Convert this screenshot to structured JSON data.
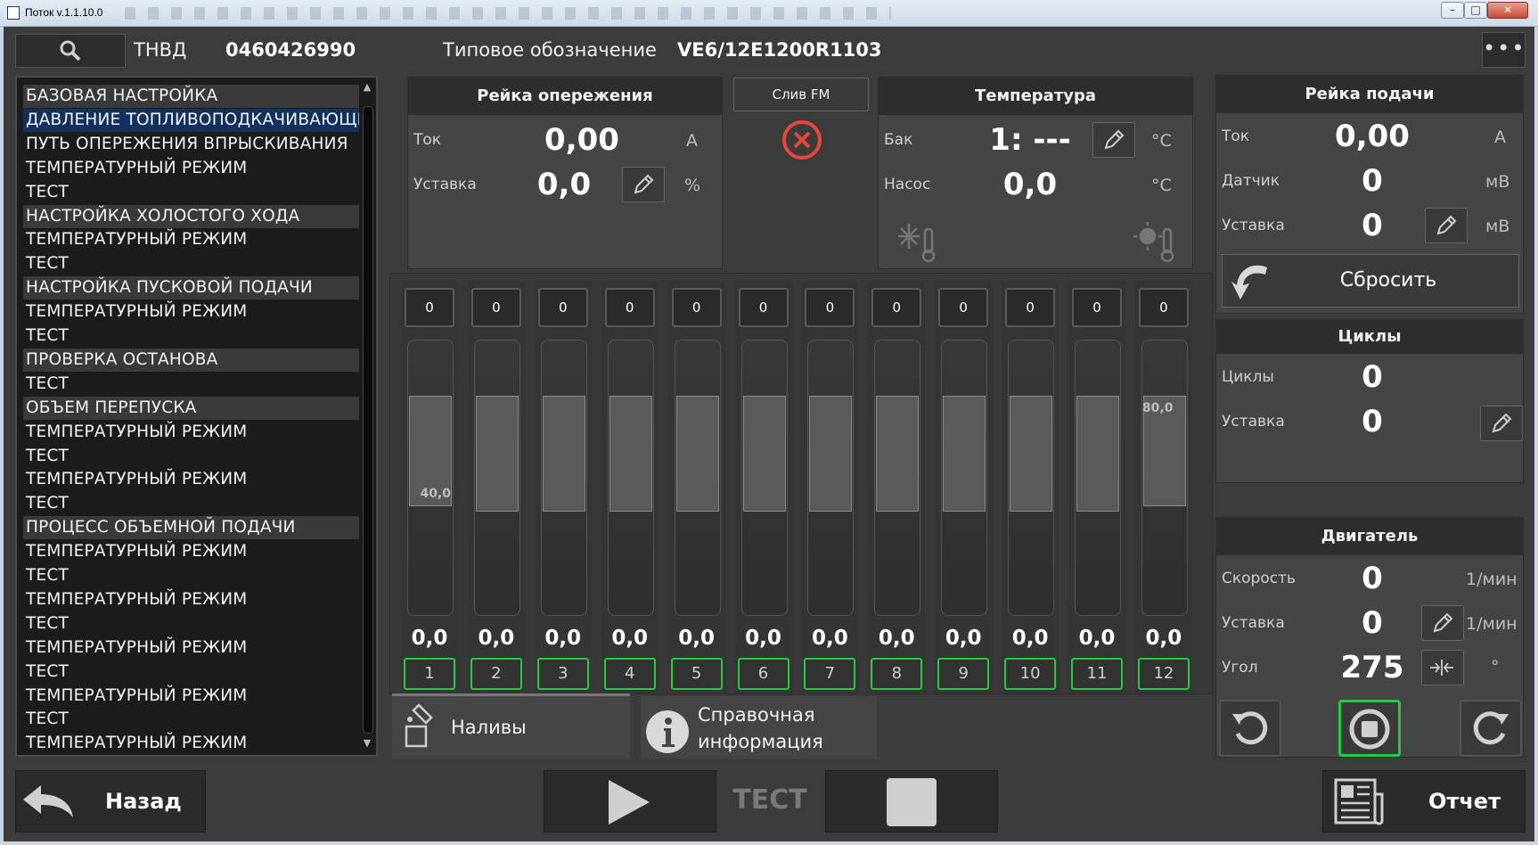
{
  "window": {
    "title": "Поток v.1.1.10.0"
  },
  "header": {
    "pump_label": "ТНВД",
    "pump_value": "0460426990",
    "type_label": "Типовое обозначение",
    "type_value": "VE6/12E1200R1103"
  },
  "test_list": {
    "items": [
      {
        "label": "БАЗОВАЯ НАСТРОЙКА",
        "kind": "section"
      },
      {
        "label": "ДАВЛЕНИЕ ТОПЛИВОПОДКАЧИВАЮЩЕГО НАСОСА",
        "kind": "selected"
      },
      {
        "label": "ПУТЬ ОПЕРЕЖЕНИЯ ВПРЫСКИВАНИЯ",
        "kind": "item"
      },
      {
        "label": "ТЕМПЕРАТУРНЫЙ РЕЖИМ",
        "kind": "item"
      },
      {
        "label": "ТЕСТ",
        "kind": "item"
      },
      {
        "label": "НАСТРОЙКА ХОЛОСТОГО ХОДА",
        "kind": "section"
      },
      {
        "label": "ТЕМПЕРАТУРНЫЙ РЕЖИМ",
        "kind": "item"
      },
      {
        "label": "ТЕСТ",
        "kind": "item"
      },
      {
        "label": "НАСТРОЙКА ПУСКОВОЙ ПОДАЧИ",
        "kind": "section"
      },
      {
        "label": "ТЕМПЕРАТУРНЫЙ РЕЖИМ",
        "kind": "item"
      },
      {
        "label": "ТЕСТ",
        "kind": "item"
      },
      {
        "label": "ПРОВЕРКА ОСТАНОВА",
        "kind": "section"
      },
      {
        "label": "ТЕСТ",
        "kind": "item"
      },
      {
        "label": "ОБЪЕМ ПЕРЕПУСКА",
        "kind": "section"
      },
      {
        "label": "ТЕМПЕРАТУРНЫЙ РЕЖИМ",
        "kind": "item"
      },
      {
        "label": "ТЕСТ",
        "kind": "item"
      },
      {
        "label": "ТЕМПЕРАТУРНЫЙ РЕЖИМ",
        "kind": "item"
      },
      {
        "label": "ТЕСТ",
        "kind": "item"
      },
      {
        "label": "ПРОЦЕСС ОБЪЕМНОЙ ПОДАЧИ",
        "kind": "section"
      },
      {
        "label": "ТЕМПЕРАТУРНЫЙ РЕЖИМ",
        "kind": "item"
      },
      {
        "label": "ТЕСТ",
        "kind": "item"
      },
      {
        "label": "ТЕМПЕРАТУРНЫЙ РЕЖИМ",
        "kind": "item"
      },
      {
        "label": "ТЕСТ",
        "kind": "item"
      },
      {
        "label": "ТЕМПЕРАТУРНЫЙ РЕЖИМ",
        "kind": "item"
      },
      {
        "label": "ТЕСТ",
        "kind": "item"
      },
      {
        "label": "ТЕМПЕРАТУРНЫЙ РЕЖИМ",
        "kind": "item"
      },
      {
        "label": "ТЕСТ",
        "kind": "item"
      },
      {
        "label": "ТЕМПЕРАТУРНЫЙ РЕЖИМ",
        "kind": "item"
      }
    ]
  },
  "advance_rack": {
    "title": "Рейка опережения",
    "current_label": "Ток",
    "current_value": "0,00",
    "current_unit": "A",
    "setpoint_label": "Уставка",
    "setpoint_value": "0,0",
    "setpoint_unit": "%"
  },
  "drain": {
    "label": "Слив FM",
    "status_icon": "error-circle-icon",
    "status_color": "#e8473a"
  },
  "temperature": {
    "title": "Температура",
    "tank_label": "Бак",
    "tank_value": "1: ---",
    "tank_unit": "°C",
    "pump_label": "Насос",
    "pump_value": "0,0",
    "pump_unit": "°C"
  },
  "feed_rack": {
    "title": "Рейка подачи",
    "current_label": "Ток",
    "current_value": "0,00",
    "current_unit": "A",
    "sensor_label": "Датчик",
    "sensor_value": "0",
    "sensor_unit": "мВ",
    "setpoint_label": "Уставка",
    "setpoint_value": "0",
    "setpoint_unit": "мВ",
    "reset_label": "Сбросить"
  },
  "cycles": {
    "title": "Циклы",
    "cycles_label": "Циклы",
    "cycles_value": "0",
    "setpoint_label": "Уставка",
    "setpoint_value": "0"
  },
  "engine": {
    "title": "Двигатель",
    "speed_label": "Скорость",
    "speed_value": "0",
    "speed_unit": "1/мин",
    "setpoint_label": "Уставка",
    "setpoint_value": "0",
    "setpoint_unit": "1/мин",
    "angle_label": "Угол",
    "angle_value": "275",
    "angle_unit": "°"
  },
  "channels": [
    {
      "index": "1",
      "top": "0",
      "value": "0,0",
      "band": [
        40,
        80
      ],
      "marker": "40,0",
      "marker_at": "low"
    },
    {
      "index": "2",
      "top": "0",
      "value": "0,0",
      "band": [
        38,
        80
      ]
    },
    {
      "index": "3",
      "top": "0",
      "value": "0,0",
      "band": [
        38,
        80
      ]
    },
    {
      "index": "4",
      "top": "0",
      "value": "0,0",
      "band": [
        38,
        80
      ]
    },
    {
      "index": "5",
      "top": "0",
      "value": "0,0",
      "band": [
        38,
        80
      ]
    },
    {
      "index": "6",
      "top": "0",
      "value": "0,0",
      "band": [
        38,
        80
      ]
    },
    {
      "index": "7",
      "top": "0",
      "value": "0,0",
      "band": [
        38,
        80
      ]
    },
    {
      "index": "8",
      "top": "0",
      "value": "0,0",
      "band": [
        38,
        80
      ]
    },
    {
      "index": "9",
      "top": "0",
      "value": "0,0",
      "band": [
        38,
        80
      ]
    },
    {
      "index": "10",
      "top": "0",
      "value": "0,0",
      "band": [
        38,
        80
      ]
    },
    {
      "index": "11",
      "top": "0",
      "value": "0,0",
      "band": [
        38,
        80
      ]
    },
    {
      "index": "12",
      "top": "0",
      "value": "0,0",
      "band": [
        40,
        80
      ],
      "marker": "80,0",
      "marker_at": "high"
    }
  ],
  "tabs": {
    "fills_label": "Наливы",
    "info_label_1": "Справочная",
    "info_label_2": "информация"
  },
  "bottom": {
    "back_label": "Назад",
    "mode_label": "ТЕСТ",
    "report_label": "Отчет"
  },
  "colors": {
    "accent_green": "#27c93f",
    "selected_row": "#13315f"
  }
}
